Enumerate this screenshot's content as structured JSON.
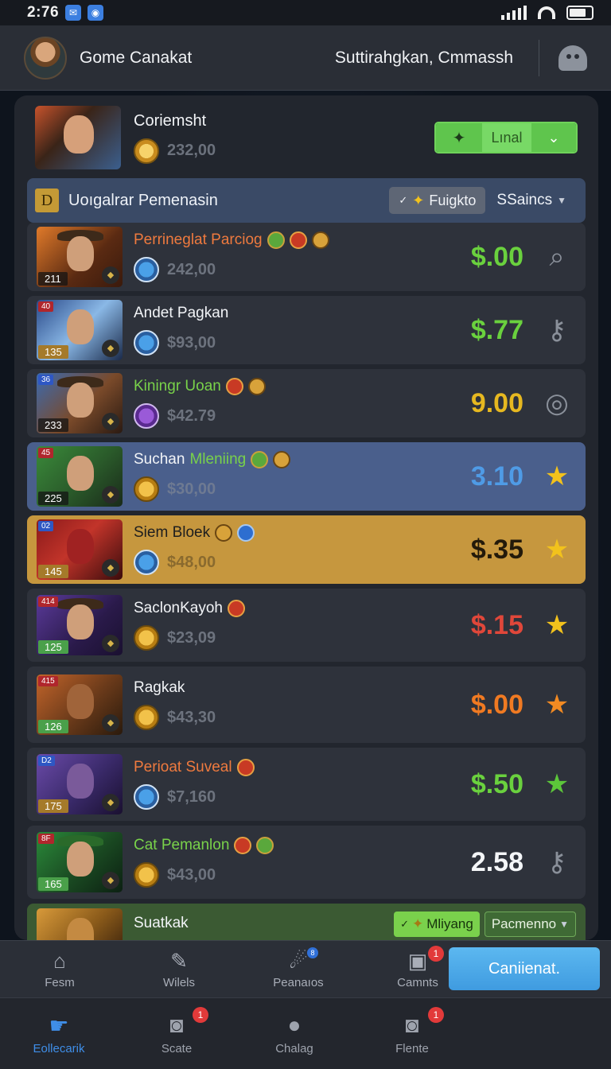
{
  "status_bar": {
    "time": "2:76"
  },
  "header": {
    "title": "Gome Canakat",
    "subtitle": "Suttirahgkan, Cmmassh"
  },
  "profile": {
    "name": "Coriemsht",
    "score": "232,00",
    "action_label": "Lınal"
  },
  "filter": {
    "badge": "D",
    "title": "Uoıgalrar Pemenasin",
    "dropdown_label": "Fuigkto",
    "sort_label": "SSaincs"
  },
  "rows": [
    {
      "rank": "211",
      "tag": "",
      "name": "Perrineglat Parciog",
      "value": "242,00",
      "amount": "$.00",
      "end_icon": "search-icon"
    },
    {
      "rank": "135",
      "tag": "40",
      "name": "Andet Pagkan",
      "value": "$93,00",
      "amount": "$.77",
      "end_icon": "key-icon"
    },
    {
      "rank": "233",
      "tag": "36",
      "name": "Kiningr Uoan",
      "value": "$42.79",
      "amount": "9.00",
      "end_icon": "coins-icon"
    },
    {
      "rank": "225",
      "tag": "45",
      "name": "Suchan",
      "name_extra": "Mleniing",
      "value": "$30,00",
      "amount": "3.10",
      "end_icon": "star-icon"
    },
    {
      "rank": "145",
      "tag": "02",
      "name": "Siem Bloek",
      "value": "$48,00",
      "amount": "$.35",
      "end_icon": "star-icon"
    },
    {
      "rank": "125",
      "tag": "414",
      "name": "SaclonKayoh",
      "value": "$23,09",
      "amount": "$.15",
      "end_icon": "star-icon"
    },
    {
      "rank": "126",
      "tag": "415",
      "name": "Ragkak",
      "value": "$43,30",
      "amount": "$.00",
      "end_icon": "star-icon"
    },
    {
      "rank": "175",
      "tag": "D2",
      "name": "Perioat Suveal",
      "value": "$7,160",
      "amount": "$.50",
      "end_icon": "star-icon"
    },
    {
      "rank": "165",
      "tag": "8F",
      "name": "Cat Pemanlon",
      "value": "$43,00",
      "amount": "2.58",
      "end_icon": "key-icon"
    }
  ],
  "partial_row": {
    "name": "Suatkak",
    "chip1": "Mliyang",
    "chip2": "Pacmenno"
  },
  "subnav": {
    "items": [
      {
        "label": "Fesm",
        "icon": "home-icon"
      },
      {
        "label": "Wilels",
        "icon": "wrench-icon"
      },
      {
        "label": "Peanaıos",
        "icon": "planet-icon",
        "badge": "8"
      },
      {
        "label": "Camnts",
        "icon": "box-icon",
        "badge": "1"
      }
    ],
    "continue_label": "Caniienat."
  },
  "bottom_nav": {
    "items": [
      {
        "label": "Eollecarik",
        "icon": "gesture-icon",
        "active": true
      },
      {
        "label": "Scate",
        "icon": "camera-icon",
        "badge": "1"
      },
      {
        "label": "Chalag",
        "icon": "chat-icon"
      },
      {
        "label": "Flente",
        "icon": "camera-icon",
        "badge": "1"
      }
    ]
  },
  "colors": {
    "accent_blue": "#3f8ee8",
    "green": "#6ad13e",
    "gold": "#c6973e"
  }
}
